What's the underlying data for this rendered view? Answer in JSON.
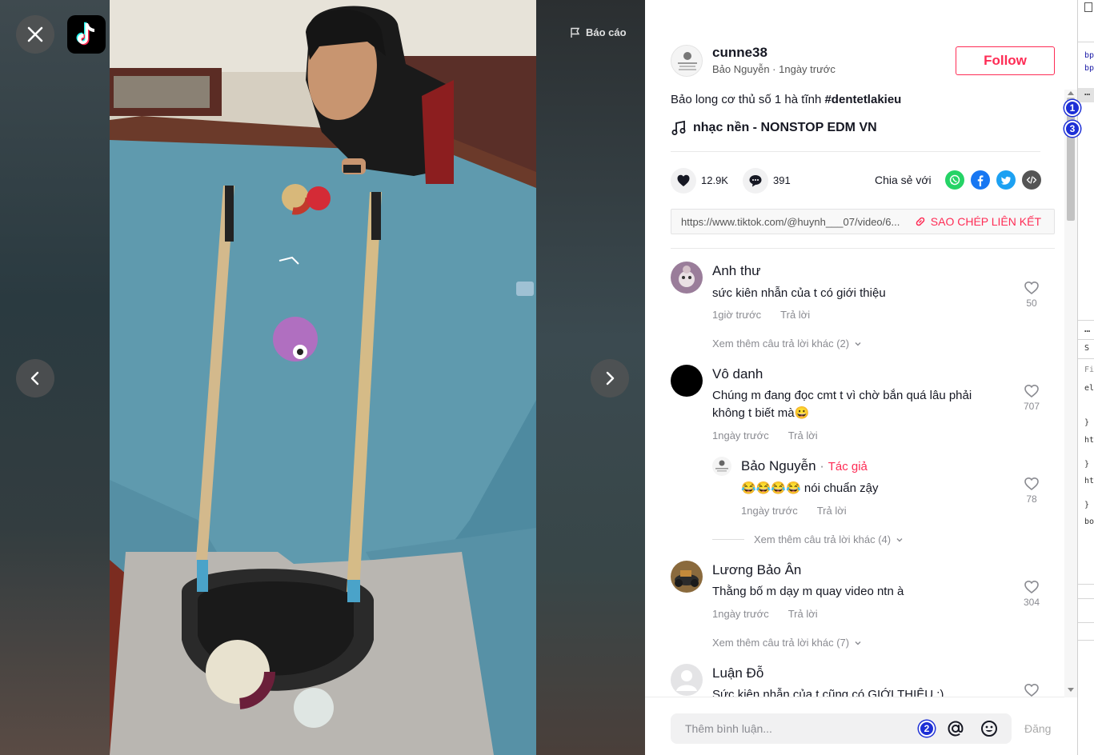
{
  "video": {
    "report_label": "Báo cáo"
  },
  "post": {
    "author_handle": "cunne38",
    "author_name": "Bảo Nguyễn",
    "time": "1ngày trước",
    "follow_label": "Follow",
    "caption_text": "Bảo long cơ thủ số 1 hà tĩnh ",
    "caption_hashtag": "#dentetlakieu",
    "music": "nhạc nền - NONSTOP EDM VN",
    "likes": "12.9K",
    "comments_count": "391",
    "share_label": "Chia sẻ với",
    "share_icons": [
      "whatsapp-icon",
      "facebook-icon",
      "twitter-icon",
      "embed-icon"
    ],
    "share_colors": {
      "whatsapp": "#25d366",
      "facebook": "#1877f2",
      "twitter": "#1da1f2",
      "embed": "#555555"
    },
    "link": "https://www.tiktok.com/@huynh___07/video/6...",
    "copy_link_label": "SAO CHÉP LIÊN KẾT"
  },
  "comments": [
    {
      "name": "Anh thư",
      "text": "sức kiên nhẫn của t có giới thiệu",
      "time": "1giờ trước",
      "reply_label": "Trả lời",
      "likes": "50",
      "more_replies": "Xem thêm câu trả lời khác (2)"
    },
    {
      "name": "Vô danh",
      "text_line1": "Chúng m đang đọc cmt t vì chờ bắn quá lâu phải",
      "text_line2": "không t biết mà😀",
      "time": "1ngày trước",
      "reply_label": "Trả lời",
      "likes": "707",
      "reply": {
        "name": "Bảo Nguyễn",
        "separator": " · ",
        "author_tag": "Tác giả",
        "emojis": "😂😂😂😂",
        "text": "nói chuẩn zậy",
        "time": "1ngày trước",
        "reply_label": "Trả lời",
        "likes": "78"
      },
      "more_replies": "Xem thêm câu trả lời khác (4)"
    },
    {
      "name": "Lương Bảo Ân",
      "text": "Thằng bố m dạy m quay video ntn à",
      "time": "1ngày trước",
      "reply_label": "Trả lời",
      "likes": "304",
      "more_replies": "Xem thêm câu trả lời khác (7)"
    },
    {
      "name": "Luận Đỗ",
      "text": "Sức kiên nhẫn của t cũng có GIỚI THIỆU :)"
    }
  ],
  "composer": {
    "placeholder": "Thêm bình luận...",
    "post_label": "Đăng"
  },
  "markers": [
    "1",
    "3",
    "2"
  ],
  "devtools": {
    "lines": [
      "bp",
      "bp",
      "S",
      "Fi",
      "el",
      "}",
      "ht",
      "}",
      "ht",
      "}",
      "bo"
    ]
  },
  "colors": {
    "accent": "#fe2c55",
    "marker": "#1d2fd6"
  }
}
